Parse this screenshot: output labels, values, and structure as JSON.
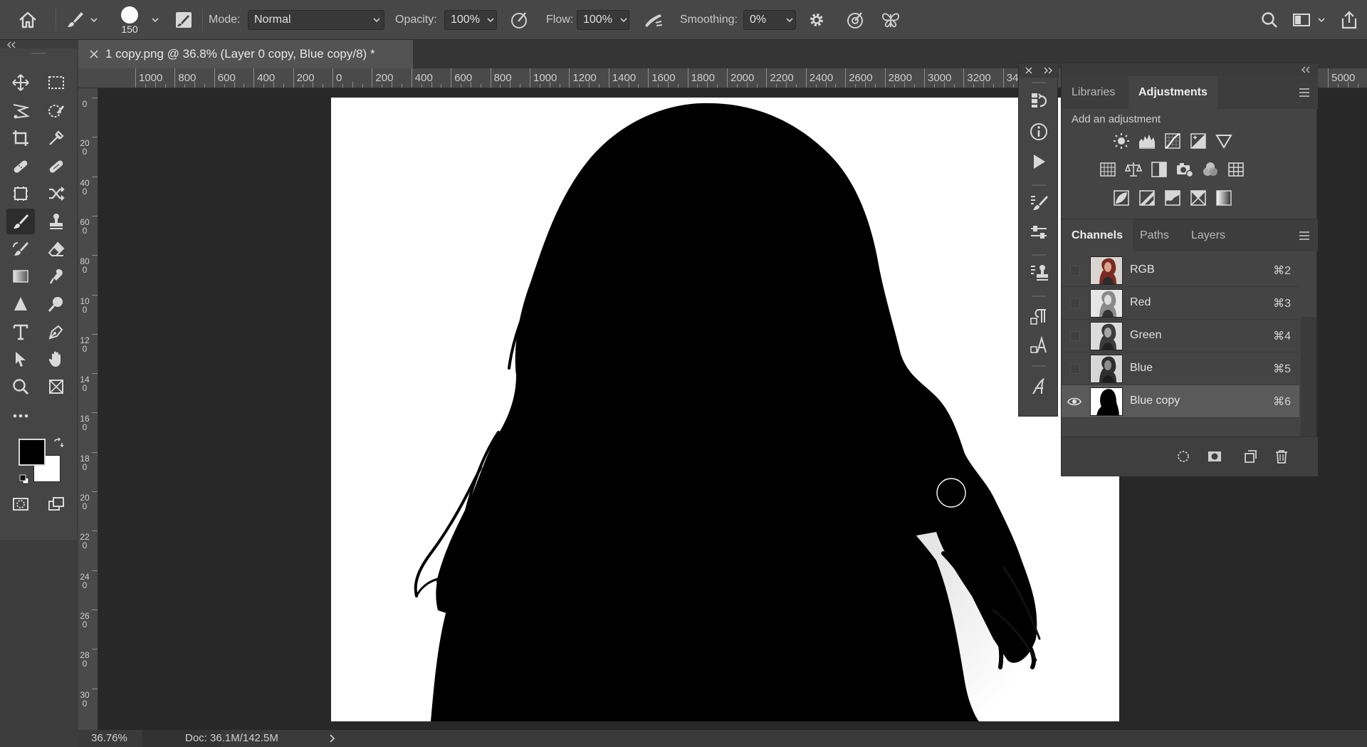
{
  "options_bar": {
    "brush_size": "150",
    "mode_label": "Mode:",
    "mode_value": "Normal",
    "opacity_label": "Opacity:",
    "opacity_value": "100%",
    "flow_label": "Flow:",
    "flow_value": "100%",
    "smoothing_label": "Smoothing:",
    "smoothing_value": "0%"
  },
  "document_tab": {
    "title": "1 copy.png @ 36.8% (Layer 0 copy, Blue copy/8) *"
  },
  "ruler_h": {
    "labels": [
      "1000",
      "800",
      "600",
      "400",
      "200",
      "0",
      "200",
      "400",
      "600",
      "800",
      "1000",
      "1200",
      "1400",
      "1600",
      "1800",
      "2000",
      "2200",
      "2400",
      "2600",
      "2800",
      "3000",
      "3200",
      "34",
      "5000"
    ]
  },
  "ruler_v": {
    "labels": [
      "0",
      "2 0 0",
      "4 0 0",
      "6 0 0",
      "8 0 0",
      "1 0 0",
      "1 2 0",
      "1 4 0",
      "1 6 0",
      "1 8 0",
      "2 0 0",
      "2 2 0",
      "2 4 0",
      "2 6 0",
      "2 8 0",
      "3 0 0"
    ]
  },
  "status_bar": {
    "zoom": "36.76%",
    "doc_size": "Doc: 36.1M/142.5M"
  },
  "adjustments_panel": {
    "tabs": [
      "Libraries",
      "Adjustments"
    ],
    "active_tab": "Adjustments",
    "title": "Add an adjustment",
    "icons": [
      "brightness-contrast-icon",
      "levels-icon",
      "curves-icon",
      "exposure-icon",
      "vibrance-icon",
      "hue-saturation-icon",
      "color-balance-icon",
      "black-white-icon",
      "photo-filter-icon",
      "channel-mixer-icon",
      "color-lookup-icon",
      "invert-icon",
      "posterize-icon",
      "threshold-icon",
      "selective-color-icon",
      "gradient-map-icon"
    ]
  },
  "channels_panel": {
    "tabs": [
      "Channels",
      "Paths",
      "Layers"
    ],
    "active_tab": "Channels",
    "rows": [
      {
        "name": "RGB",
        "shortcut": "⌘2",
        "visible": false,
        "selected": false
      },
      {
        "name": "Red",
        "shortcut": "⌘3",
        "visible": false,
        "selected": false
      },
      {
        "name": "Green",
        "shortcut": "⌘4",
        "visible": false,
        "selected": false
      },
      {
        "name": "Blue",
        "shortcut": "⌘5",
        "visible": false,
        "selected": false
      },
      {
        "name": "Blue copy",
        "shortcut": "⌘6",
        "visible": true,
        "selected": true
      }
    ]
  },
  "colors": {
    "foreground": "#000000",
    "background": "#ffffff",
    "panel": "#444444",
    "selected_row": "#5a5a5a"
  }
}
